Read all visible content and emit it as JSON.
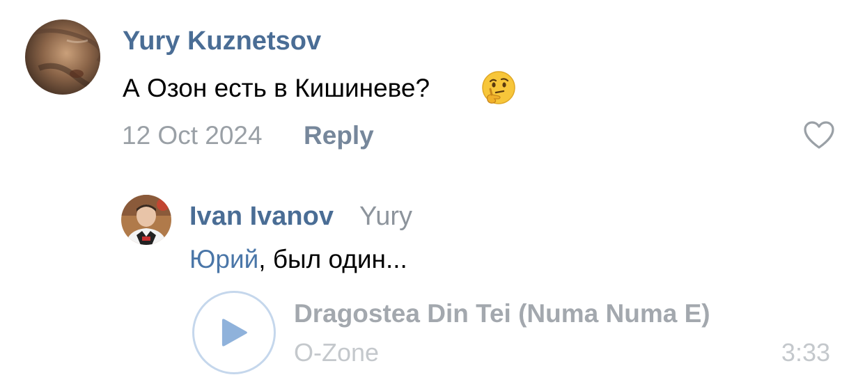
{
  "comment": {
    "author": "Yury Kuznetsov",
    "text": "А Озон есть в Кишиневе?",
    "emoji": "thinking-face",
    "date": "12 Oct 2024",
    "reply_label": "Reply",
    "like_icon": "heart-outline-icon"
  },
  "reply": {
    "author": "Ivan Ivanov",
    "reply_to": "Yury",
    "mention": "Юрий",
    "text": ", был один...",
    "attachment": {
      "type": "audio",
      "title": "Dragostea Din Tei (Numa Numa E)",
      "artist": "O-Zone",
      "duration": "3:33",
      "play_icon": "play-icon"
    }
  },
  "colors": {
    "author": "#4a6d95",
    "mention": "#4a76a8",
    "meta": "#9aa0a6",
    "play_accent": "#8fb2db"
  }
}
